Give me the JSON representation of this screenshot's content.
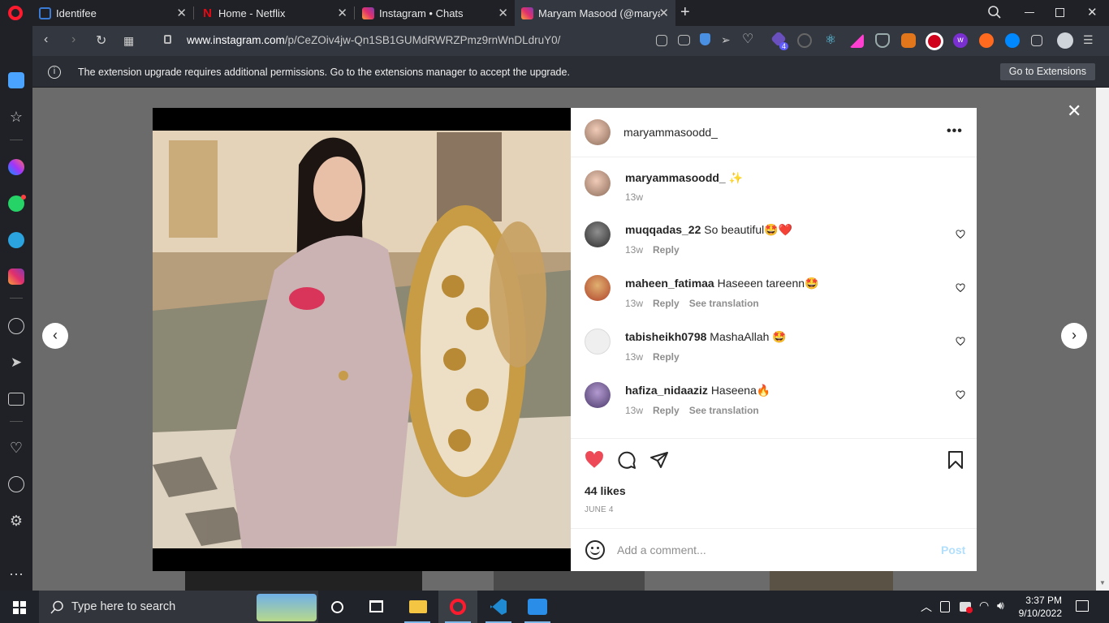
{
  "tabs": [
    {
      "label": "Identifee",
      "icon": "identifee-icon"
    },
    {
      "label": "Home - Netflix",
      "icon": "netflix-icon"
    },
    {
      "label": "Instagram • Chats",
      "icon": "instagram-icon"
    },
    {
      "label": "Maryam Masood (@maryar",
      "icon": "instagram-icon"
    }
  ],
  "address": {
    "url_host": "www.instagram.com",
    "url_path": "/p/CeZOiv4jw-Qn1SB1GUMdRWRZPmz9rnWnDLdruY0/",
    "extension_badge": "4"
  },
  "notification": {
    "text": "The extension upgrade requires additional permissions. Go to the extensions manager to accept the upgrade.",
    "button_label": "Go to Extensions"
  },
  "post": {
    "author": "maryammasoodd_",
    "caption_emoji": "✨",
    "caption_time": "13w",
    "likes": "44 likes",
    "date": "JUNE 4",
    "comment_placeholder": "Add a comment...",
    "post_label": "Post"
  },
  "comments": [
    {
      "user": "muqqadas_22",
      "text": "So beautiful🤩❤️",
      "time": "13w",
      "reply": "Reply",
      "translate": ""
    },
    {
      "user": "maheen_fatimaa",
      "text": "Haseeen tareenn🤩",
      "time": "13w",
      "reply": "Reply",
      "translate": "See translation"
    },
    {
      "user": "tabisheikh0798",
      "text": "MashaAllah 🤩",
      "time": "13w",
      "reply": "Reply",
      "translate": ""
    },
    {
      "user": "hafiza_nidaaziz",
      "text": "Haseena🔥",
      "time": "13w",
      "reply": "Reply",
      "translate": "See translation"
    }
  ],
  "taskbar": {
    "search_placeholder": "Type here to search",
    "time": "3:37 PM",
    "date": "9/10/2022"
  },
  "colors": {
    "like_red": "#ed4956",
    "post_blue": "#b2dffc",
    "opera_red": "#ff1b2d"
  }
}
